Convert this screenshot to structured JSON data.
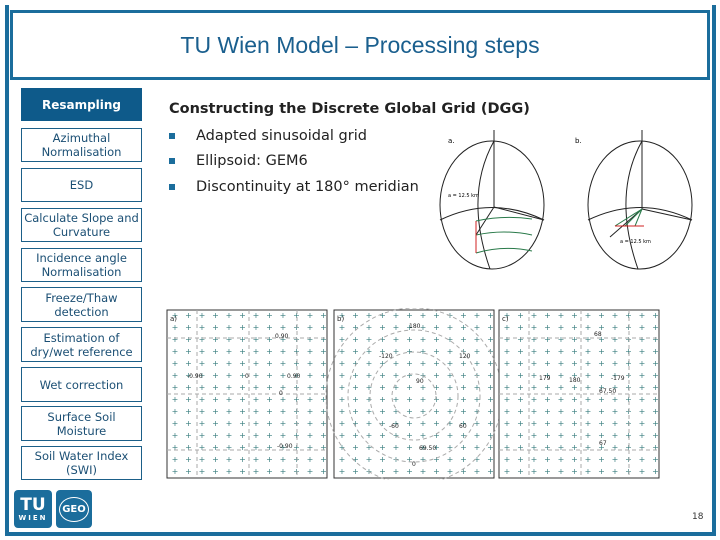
{
  "title": "TU Wien Model – Processing steps",
  "steps": [
    "Resampling",
    "Azimuthal Normalisation",
    "ESD",
    "Calculate Slope and Curvature",
    "Incidence angle Normalisation",
    "Freeze/Thaw detection",
    "Estimation of dry/wet reference",
    "Wet correction",
    "Surface Soil Moisture",
    "Soil Water Index (SWI)"
  ],
  "active_step": "Resampling",
  "heading": "Constructing the Discrete Global Grid (DGG)",
  "bullets": [
    "Adapted sinusoidal grid",
    "Ellipsoid: GEM6",
    "Discontinuity at 180° meridian"
  ],
  "spheres": {
    "a": {
      "label": "a.",
      "note": "a = 12.5 km"
    },
    "b": {
      "label": "b.",
      "note": "a = 12.5 km"
    }
  },
  "grids": {
    "a": {
      "label": "a)",
      "marks": [
        "0.90",
        "-0.90",
        "0",
        "0.90",
        "0",
        "-0.90"
      ]
    },
    "b": {
      "label": "b)",
      "marks": [
        "180",
        "-120",
        "120",
        "90",
        "-60",
        "60",
        "69.50",
        "0"
      ]
    },
    "c": {
      "label": "c)",
      "marks": [
        "68",
        "179",
        "180",
        "-179",
        "67.50",
        "67"
      ]
    }
  },
  "logos": {
    "tu": "TU WIEN",
    "geo": "GEO"
  },
  "page_number": "18",
  "colors": {
    "accent": "#1b6d9c",
    "active_fill": "#0e5a8a"
  }
}
